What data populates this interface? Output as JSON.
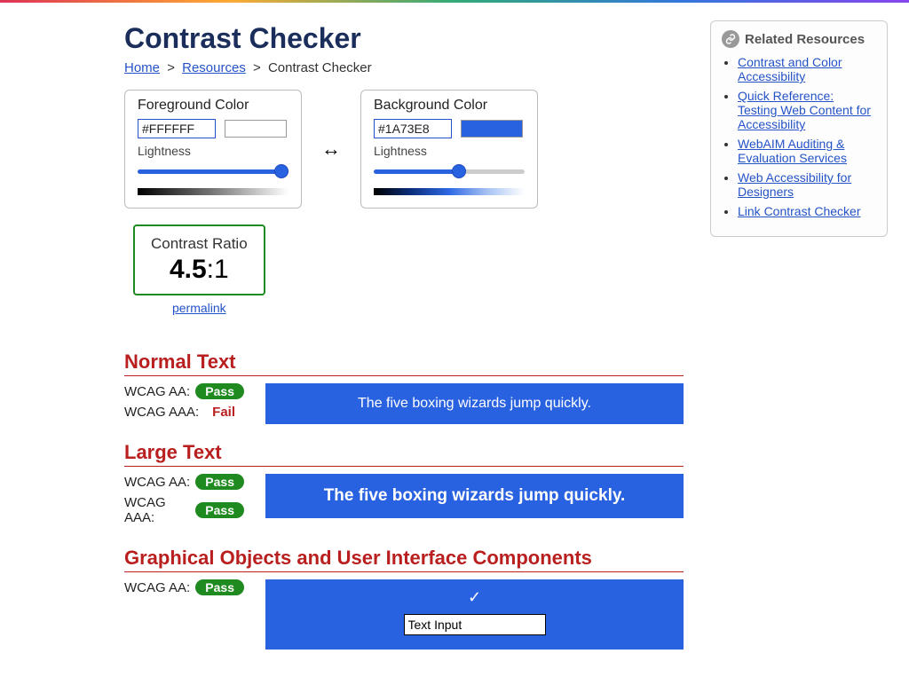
{
  "title": "Contrast Checker",
  "breadcrumb": {
    "home": "Home",
    "resources": "Resources",
    "current": "Contrast Checker"
  },
  "foreground": {
    "legend": "Foreground Color",
    "value": "#FFFFFF",
    "lightness_label": "Lightness"
  },
  "background": {
    "legend": "Background Color",
    "value": "#1A73E8",
    "lightness_label": "Lightness"
  },
  "swap_label": "↔",
  "ratio": {
    "label": "Contrast Ratio",
    "value": "4.5",
    "suffix": ":1",
    "permalink": "permalink"
  },
  "sample_text": "The five boxing wizards jump quickly.",
  "sections": {
    "normal": {
      "heading": "Normal Text",
      "aa_label": "WCAG AA:",
      "aa_status": "Pass",
      "aaa_label": "WCAG AAA:",
      "aaa_status": "Fail"
    },
    "large": {
      "heading": "Large Text",
      "aa_label": "WCAG AA:",
      "aa_status": "Pass",
      "aaa_label": "WCAG AAA:",
      "aaa_status": "Pass"
    },
    "ui": {
      "heading": "Graphical Objects and User Interface Components",
      "aa_label": "WCAG AA:",
      "aa_status": "Pass",
      "input_value": "Text Input"
    }
  },
  "sidebar": {
    "heading": "Related Resources",
    "links": [
      "Contrast and Color Accessibility",
      "Quick Reference: Testing Web Content for Accessibility",
      "WebAIM Auditing & Evaluation Services",
      "Web Accessibility for Designers",
      "Link Contrast Checker"
    ]
  }
}
